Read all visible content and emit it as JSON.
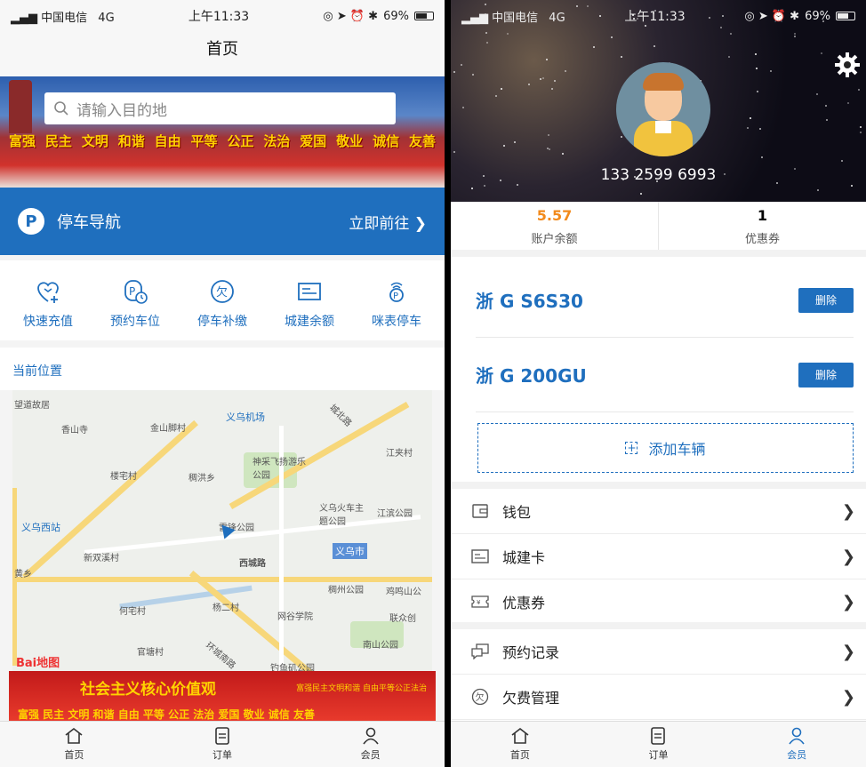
{
  "left": {
    "status": {
      "carrier": "中国电信",
      "network": "4G",
      "time": "上午11:33",
      "battery": "69%"
    },
    "title": "首页",
    "banner": {
      "search_placeholder": "请输入目的地",
      "values": [
        "富强",
        "民主",
        "文明",
        "和谐",
        "自由",
        "平等",
        "公正",
        "法治",
        "爱国",
        "敬业",
        "诚信",
        "友善"
      ]
    },
    "nav_bar": {
      "label": "停车导航",
      "action": "立即前往",
      "badge": "P"
    },
    "quick_actions": [
      {
        "label": "快速充值",
        "icon": "recharge-icon"
      },
      {
        "label": "预约车位",
        "icon": "reserve-parking-icon"
      },
      {
        "label": "停车补缴",
        "icon": "owe-icon"
      },
      {
        "label": "城建余额",
        "icon": "card-icon"
      },
      {
        "label": "咪表停车",
        "icon": "meter-icon"
      }
    ],
    "location_title": "当前位置",
    "map": {
      "labels": {
        "a": "望道故居",
        "b": "香山寺",
        "c": "金山脚村",
        "d": "义乌机场",
        "e": "城北路",
        "f": "神采飞扬游乐公园",
        "g": "楼宅村",
        "h": "稠洪乡",
        "i": "义乌西站",
        "j": "新双溪村",
        "k": "雷锋公园",
        "l": "义乌火车主题公园",
        "m": "江滨公园",
        "n": "西城路",
        "o": "义乌市",
        "p": "何宅村",
        "q": "杨二村",
        "r": "稠州公园",
        "s": "鸡鸣山公",
        "t": "网谷学院",
        "u": "联众创",
        "v": "南山公园",
        "w": "官塘村",
        "x": "环城南路",
        "y": "钓鱼矶公园",
        "z": "黄乡",
        "aa": "江夹村"
      },
      "logo": "Bai地图"
    },
    "bottom_banner": {
      "title": "社会主义核心价值观",
      "slogan": "富强民主文明和谐 自由平等公正法治",
      "values_line": "富强  民主  文明  和谐  自由  平等  公正  法治  爱国  敬业  诚信  友善"
    }
  },
  "right": {
    "status": {
      "carrier": "中国电信",
      "network": "4G",
      "time": "上午11:33",
      "battery": "69%"
    },
    "phone": "133 2599 6993",
    "stats": [
      {
        "value": "5.57",
        "caption": "账户余额",
        "color": "#f28a1c"
      },
      {
        "value": "1",
        "caption": "优惠券",
        "color": "#222222"
      }
    ],
    "cars": [
      {
        "plate": "浙 G S6S30",
        "delete": "删除"
      },
      {
        "plate": "浙 G 200GU",
        "delete": "删除"
      }
    ],
    "add_car": {
      "label": "添加车辆",
      "plus": "+"
    },
    "menu1": [
      {
        "label": "钱包",
        "icon": "wallet-icon"
      },
      {
        "label": "城建卡",
        "icon": "card-icon"
      },
      {
        "label": "优惠券",
        "icon": "coupon-icon"
      }
    ],
    "menu2": [
      {
        "label": "预约记录",
        "icon": "reservation-icon"
      },
      {
        "label": "欠费管理",
        "icon": "owe-icon"
      }
    ]
  },
  "tabs": [
    {
      "label": "首页",
      "icon": "home-icon"
    },
    {
      "label": "订单",
      "icon": "orders-icon"
    },
    {
      "label": "会员",
      "icon": "member-icon"
    }
  ],
  "colors": {
    "accent": "#1f6fbe",
    "balance": "#f28a1c"
  }
}
